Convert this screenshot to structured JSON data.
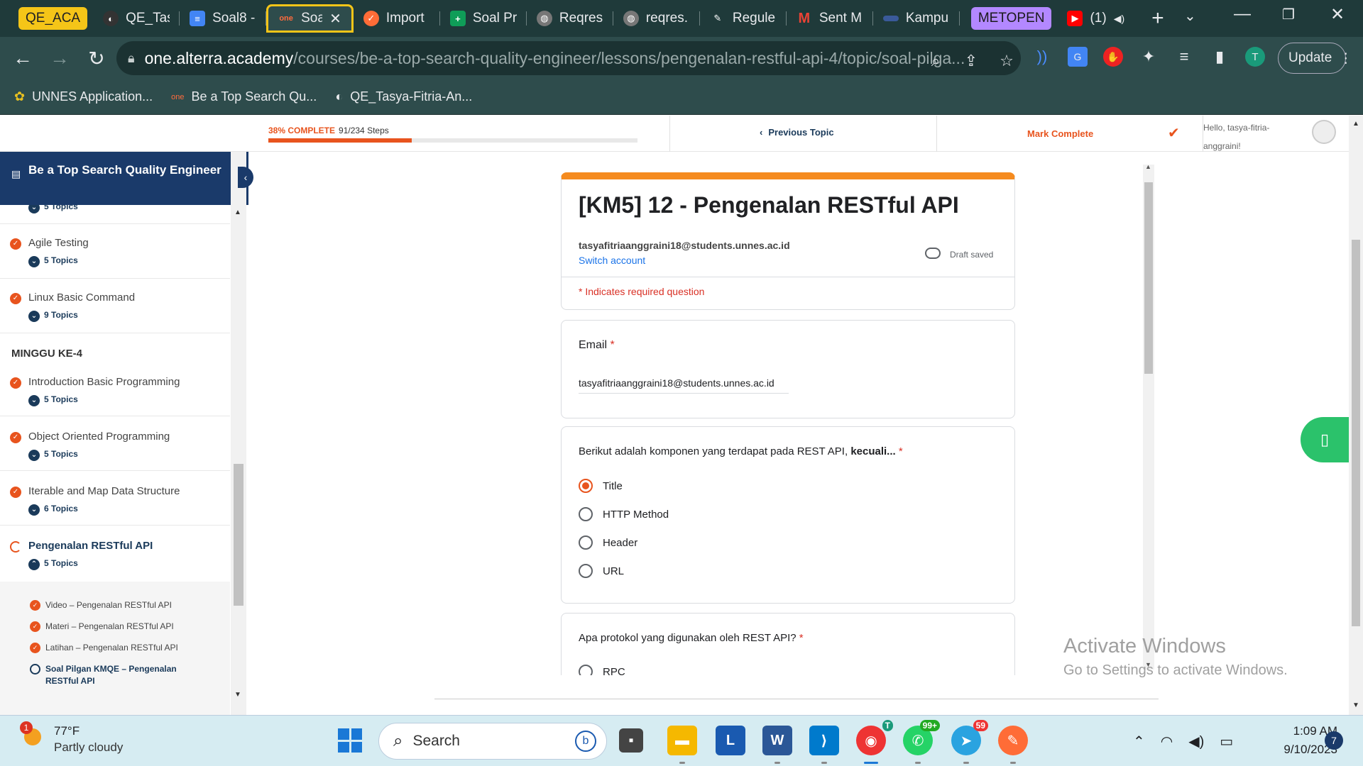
{
  "browser": {
    "tabs": [
      {
        "label": "QE_ACA",
        "kind": "group-pill",
        "color": "#f5c518"
      },
      {
        "label": "QE_Tas",
        "icon": "github-icon"
      },
      {
        "label": "Soal8 -",
        "icon": "docs-icon"
      },
      {
        "label": "Soa",
        "icon": "alterra-icon",
        "active": true
      },
      {
        "label": "Import",
        "icon": "postman-icon"
      },
      {
        "label": "Soal Pr",
        "icon": "sheets-icon"
      },
      {
        "label": "Reqres",
        "icon": "globe-icon"
      },
      {
        "label": "reqres.",
        "icon": "globe-icon"
      },
      {
        "label": "Regule",
        "icon": "tool-icon"
      },
      {
        "label": "Sent M",
        "icon": "gmail-icon"
      },
      {
        "label": "Kampu",
        "icon": "kampus-icon"
      },
      {
        "label": "METOPEN",
        "kind": "group-pill",
        "color": "#b388ff"
      },
      {
        "label": "(1)",
        "icon": "youtube-icon"
      }
    ],
    "url_domain": "one.alterra.academy",
    "url_path": "/courses/be-a-top-search-quality-engineer/lessons/pengenalan-restful-api-4/topic/soal-pilga...",
    "update_label": "Update",
    "profile_initial": "T",
    "bookmarks": [
      {
        "label": "UNNES Application...",
        "icon": "unnes-icon"
      },
      {
        "label": "Be a Top Search Qu...",
        "icon": "alterra-icon"
      },
      {
        "label": "QE_Tasya-Fitria-An...",
        "icon": "github-icon"
      }
    ]
  },
  "lms": {
    "progress_percent_label": "38% COMPLETE",
    "progress_steps": "91/234 Steps",
    "progress_fraction": 0.389,
    "previous_topic": "Previous Topic",
    "mark_complete": "Mark Complete",
    "hello": "Hello, tasya-fitria-anggraini!"
  },
  "sidebar": {
    "course_title": "Be a Top Search Quality Engineer",
    "partial_top": "5 Topics",
    "lessons_before": [
      {
        "title": "Agile Testing",
        "topics": "5 Topics"
      },
      {
        "title": "Linux Basic Command",
        "topics": "9 Topics"
      }
    ],
    "week_heading": "MINGGU KE-4",
    "lessons_after": [
      {
        "title": "Introduction Basic Programming",
        "topics": "5 Topics"
      },
      {
        "title": "Object Oriented Programming",
        "topics": "5 Topics"
      },
      {
        "title": "Iterable and Map Data Structure",
        "topics": "6 Topics"
      }
    ],
    "current_lesson": {
      "title": "Pengenalan RESTful API",
      "topics": "5 Topics"
    },
    "subtopics": [
      {
        "title": "Video – Pengenalan RESTful API",
        "done": true
      },
      {
        "title": "Materi – Pengenalan RESTful API",
        "done": true
      },
      {
        "title": "Latihan – Pengenalan RESTful API",
        "done": true
      },
      {
        "title": "Soal Pilgan KMQE – Pengenalan RESTful API",
        "done": false,
        "current": true
      }
    ]
  },
  "form": {
    "title": "[KM5] 12 - Pengenalan RESTful API",
    "account_email": "tasyafitriaanggraini18@students.unnes.ac.id",
    "switch_account": "Switch account",
    "draft_status": "Draft saved",
    "required_note": "* Indicates required question",
    "email_label": "Email",
    "email_value": "tasyafitriaanggraini18@students.unnes.ac.id",
    "q1": {
      "text": "Berikut adalah komponen yang terdapat pada REST API, ",
      "emphasis": "kecuali...",
      "options": [
        "Title",
        "HTTP Method",
        "Header",
        "URL"
      ],
      "selected": "Title"
    },
    "q2": {
      "text": "Apa protokol yang digunakan oleh REST API?",
      "first_option": "RPC"
    },
    "required_mark": "*"
  },
  "watermark": {
    "line1": "Activate Windows",
    "line2": "Go to Settings to activate Windows."
  },
  "taskbar": {
    "weather_temp": "77°F",
    "weather_desc": "Partly cloudy",
    "weather_badge": "1",
    "search_label": "Search",
    "whatsapp_badge": "99+",
    "telegram_badge": "59",
    "time": "1:09 AM",
    "date": "9/10/2023",
    "notifications": "7"
  },
  "colors": {
    "accent_orange": "#e8541e",
    "navy": "#1a3a6a",
    "form_top": "#f58b1f",
    "chrome_frame": "#2e4c4c"
  }
}
